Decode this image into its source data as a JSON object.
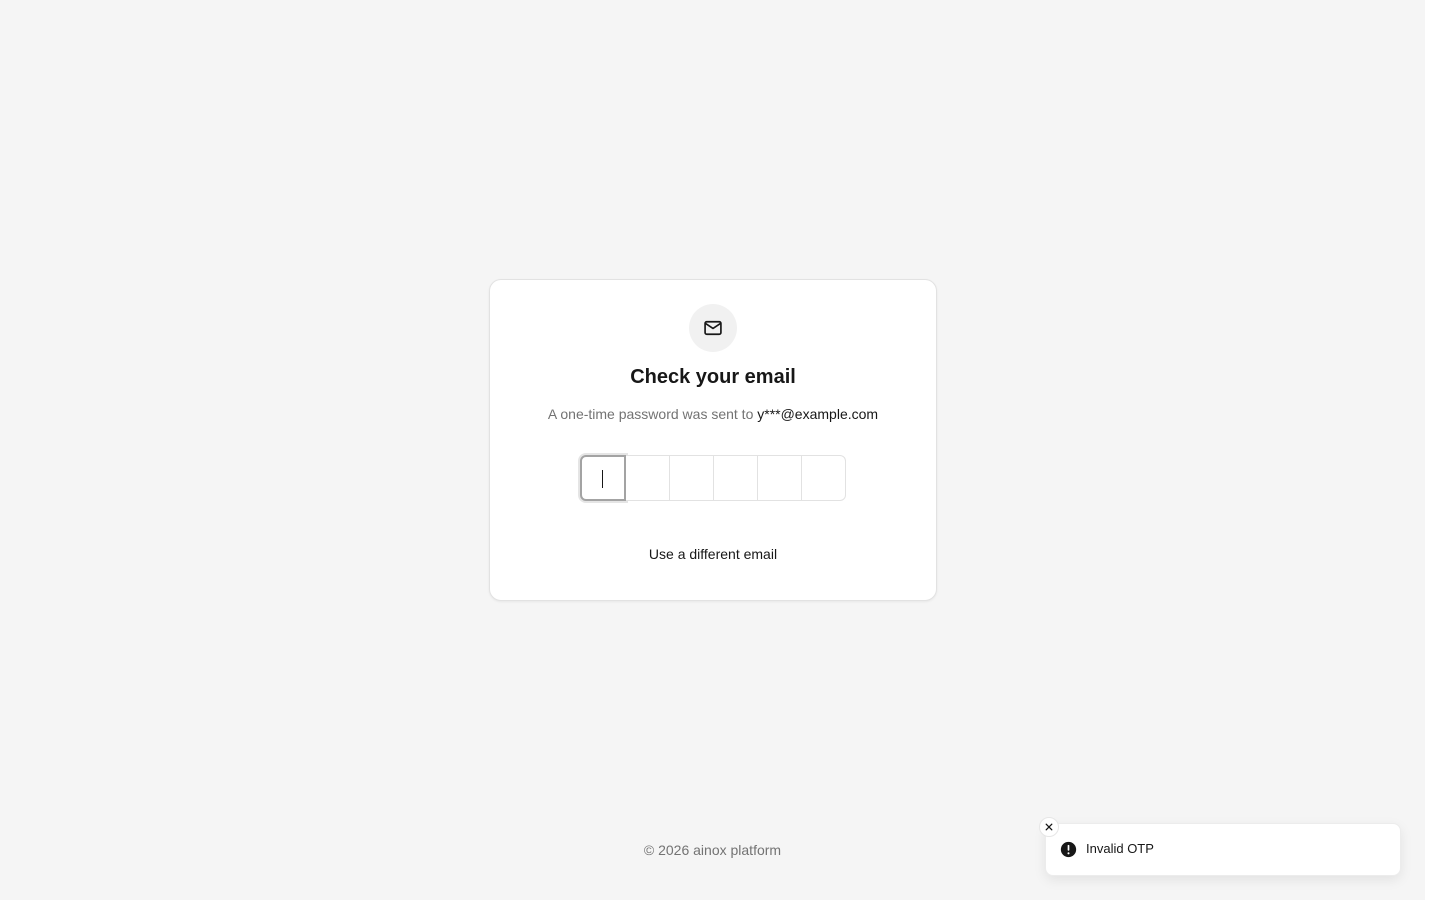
{
  "card": {
    "icon": "mail-icon",
    "title": "Check your email",
    "subtitle_prefix": "A one-time password was sent to ",
    "email": "y***@example.com",
    "otp_slots": [
      "",
      "",
      "",
      "",
      "",
      ""
    ],
    "different_email_label": "Use a different email"
  },
  "footer": {
    "copyright": "© 2026 ainox platform"
  },
  "toast": {
    "icon": "alert-circle-icon",
    "message": "Invalid OTP",
    "close_icon": "close-icon"
  },
  "colors": {
    "background": "#f5f5f5",
    "card": "#ffffff",
    "text": "#171717",
    "muted": "#737373"
  }
}
